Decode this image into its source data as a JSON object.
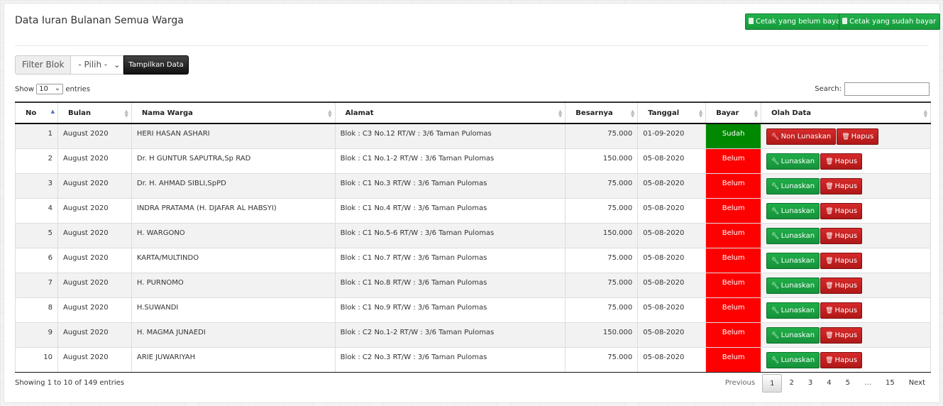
{
  "page": {
    "title": "Data Iuran Bulanan Semua Warga",
    "btn_unpaid": "Cetak yang belum bayar",
    "btn_paid": "Cetak yang sudah bayar"
  },
  "filter": {
    "label": "Filter Blok",
    "selected": "- Pilih -",
    "button": "Tampilkan Data"
  },
  "length": {
    "show": "Show",
    "value": "10",
    "entries": "entries"
  },
  "search": {
    "label": "Search:",
    "value": ""
  },
  "table": {
    "headers": [
      "No",
      "Bulan",
      "Nama Warga",
      "Alamat",
      "Besarnya",
      "Tanggal",
      "Bayar",
      "Olah Data"
    ],
    "rows": [
      {
        "no": "1",
        "bulan": "August 2020",
        "nama": "HERI HASAN ASHARI",
        "alamat": "Blok : C3 No.12 RT/W : 3/6 Taman Pulomas",
        "besar": "75.000",
        "tanggal": "01-09-2020",
        "bayar": "Sudah",
        "aksi1": "Non Lunaskan",
        "aksi2": "Hapus"
      },
      {
        "no": "2",
        "bulan": "August 2020",
        "nama": "Dr. H GUNTUR SAPUTRA,Sp RAD",
        "alamat": "Blok : C1 No.1-2 RT/W : 3/6 Taman Pulomas",
        "besar": "150.000",
        "tanggal": "05-08-2020",
        "bayar": "Belum",
        "aksi1": "Lunaskan",
        "aksi2": "Hapus"
      },
      {
        "no": "3",
        "bulan": "August 2020",
        "nama": "Dr. H. AHMAD SIBLI,SpPD",
        "alamat": "Blok : C1 No.3 RT/W : 3/6 Taman Pulomas",
        "besar": "75.000",
        "tanggal": "05-08-2020",
        "bayar": "Belum",
        "aksi1": "Lunaskan",
        "aksi2": "Hapus"
      },
      {
        "no": "4",
        "bulan": "August 2020",
        "nama": "INDRA PRATAMA (H. DJAFAR AL HABSYI)",
        "alamat": "Blok : C1 No.4 RT/W : 3/6 Taman Pulomas",
        "besar": "75.000",
        "tanggal": "05-08-2020",
        "bayar": "Belum",
        "aksi1": "Lunaskan",
        "aksi2": "Hapus"
      },
      {
        "no": "5",
        "bulan": "August 2020",
        "nama": "H. WARGONO",
        "alamat": "Blok : C1 No.5-6 RT/W : 3/6 Taman Pulomas",
        "besar": "150.000",
        "tanggal": "05-08-2020",
        "bayar": "Belum",
        "aksi1": "Lunaskan",
        "aksi2": "Hapus"
      },
      {
        "no": "6",
        "bulan": "August 2020",
        "nama": "KARTA/MULTINDO",
        "alamat": "Blok : C1 No.7 RT/W : 3/6 Taman Pulomas",
        "besar": "75.000",
        "tanggal": "05-08-2020",
        "bayar": "Belum",
        "aksi1": "Lunaskan",
        "aksi2": "Hapus"
      },
      {
        "no": "7",
        "bulan": "August 2020",
        "nama": "H. PURNOMO",
        "alamat": "Blok : C1 No.8 RT/W : 3/6 Taman Pulomas",
        "besar": "75.000",
        "tanggal": "05-08-2020",
        "bayar": "Belum",
        "aksi1": "Lunaskan",
        "aksi2": "Hapus"
      },
      {
        "no": "8",
        "bulan": "August 2020",
        "nama": "H.SUWANDI",
        "alamat": "Blok : C1 No.9 RT/W : 3/6 Taman Pulomas",
        "besar": "75.000",
        "tanggal": "05-08-2020",
        "bayar": "Belum",
        "aksi1": "Lunaskan",
        "aksi2": "Hapus"
      },
      {
        "no": "9",
        "bulan": "August 2020",
        "nama": "H. MAGMA JUNAEDI",
        "alamat": "Blok : C2 No.1-2 RT/W : 3/6 Taman Pulomas",
        "besar": "150.000",
        "tanggal": "05-08-2020",
        "bayar": "Belum",
        "aksi1": "Lunaskan",
        "aksi2": "Hapus"
      },
      {
        "no": "10",
        "bulan": "August 2020",
        "nama": "ARIE JUWARIYAH",
        "alamat": "Blok : C2 No.3 RT/W : 3/6 Taman Pulomas",
        "besar": "75.000",
        "tanggal": "05-08-2020",
        "bayar": "Belum",
        "aksi1": "Lunaskan",
        "aksi2": "Hapus"
      }
    ]
  },
  "footer": {
    "info": "Showing 1 to 10 of 149 entries",
    "previous": "Previous",
    "pages": [
      "1",
      "2",
      "3",
      "4",
      "5",
      "…",
      "15"
    ],
    "current_page": "1",
    "next": "Next"
  },
  "colors": {
    "paid": "#008800",
    "unpaid": "#ff0000",
    "button_green": "#1fae48",
    "button_red": "#d62a2a"
  }
}
